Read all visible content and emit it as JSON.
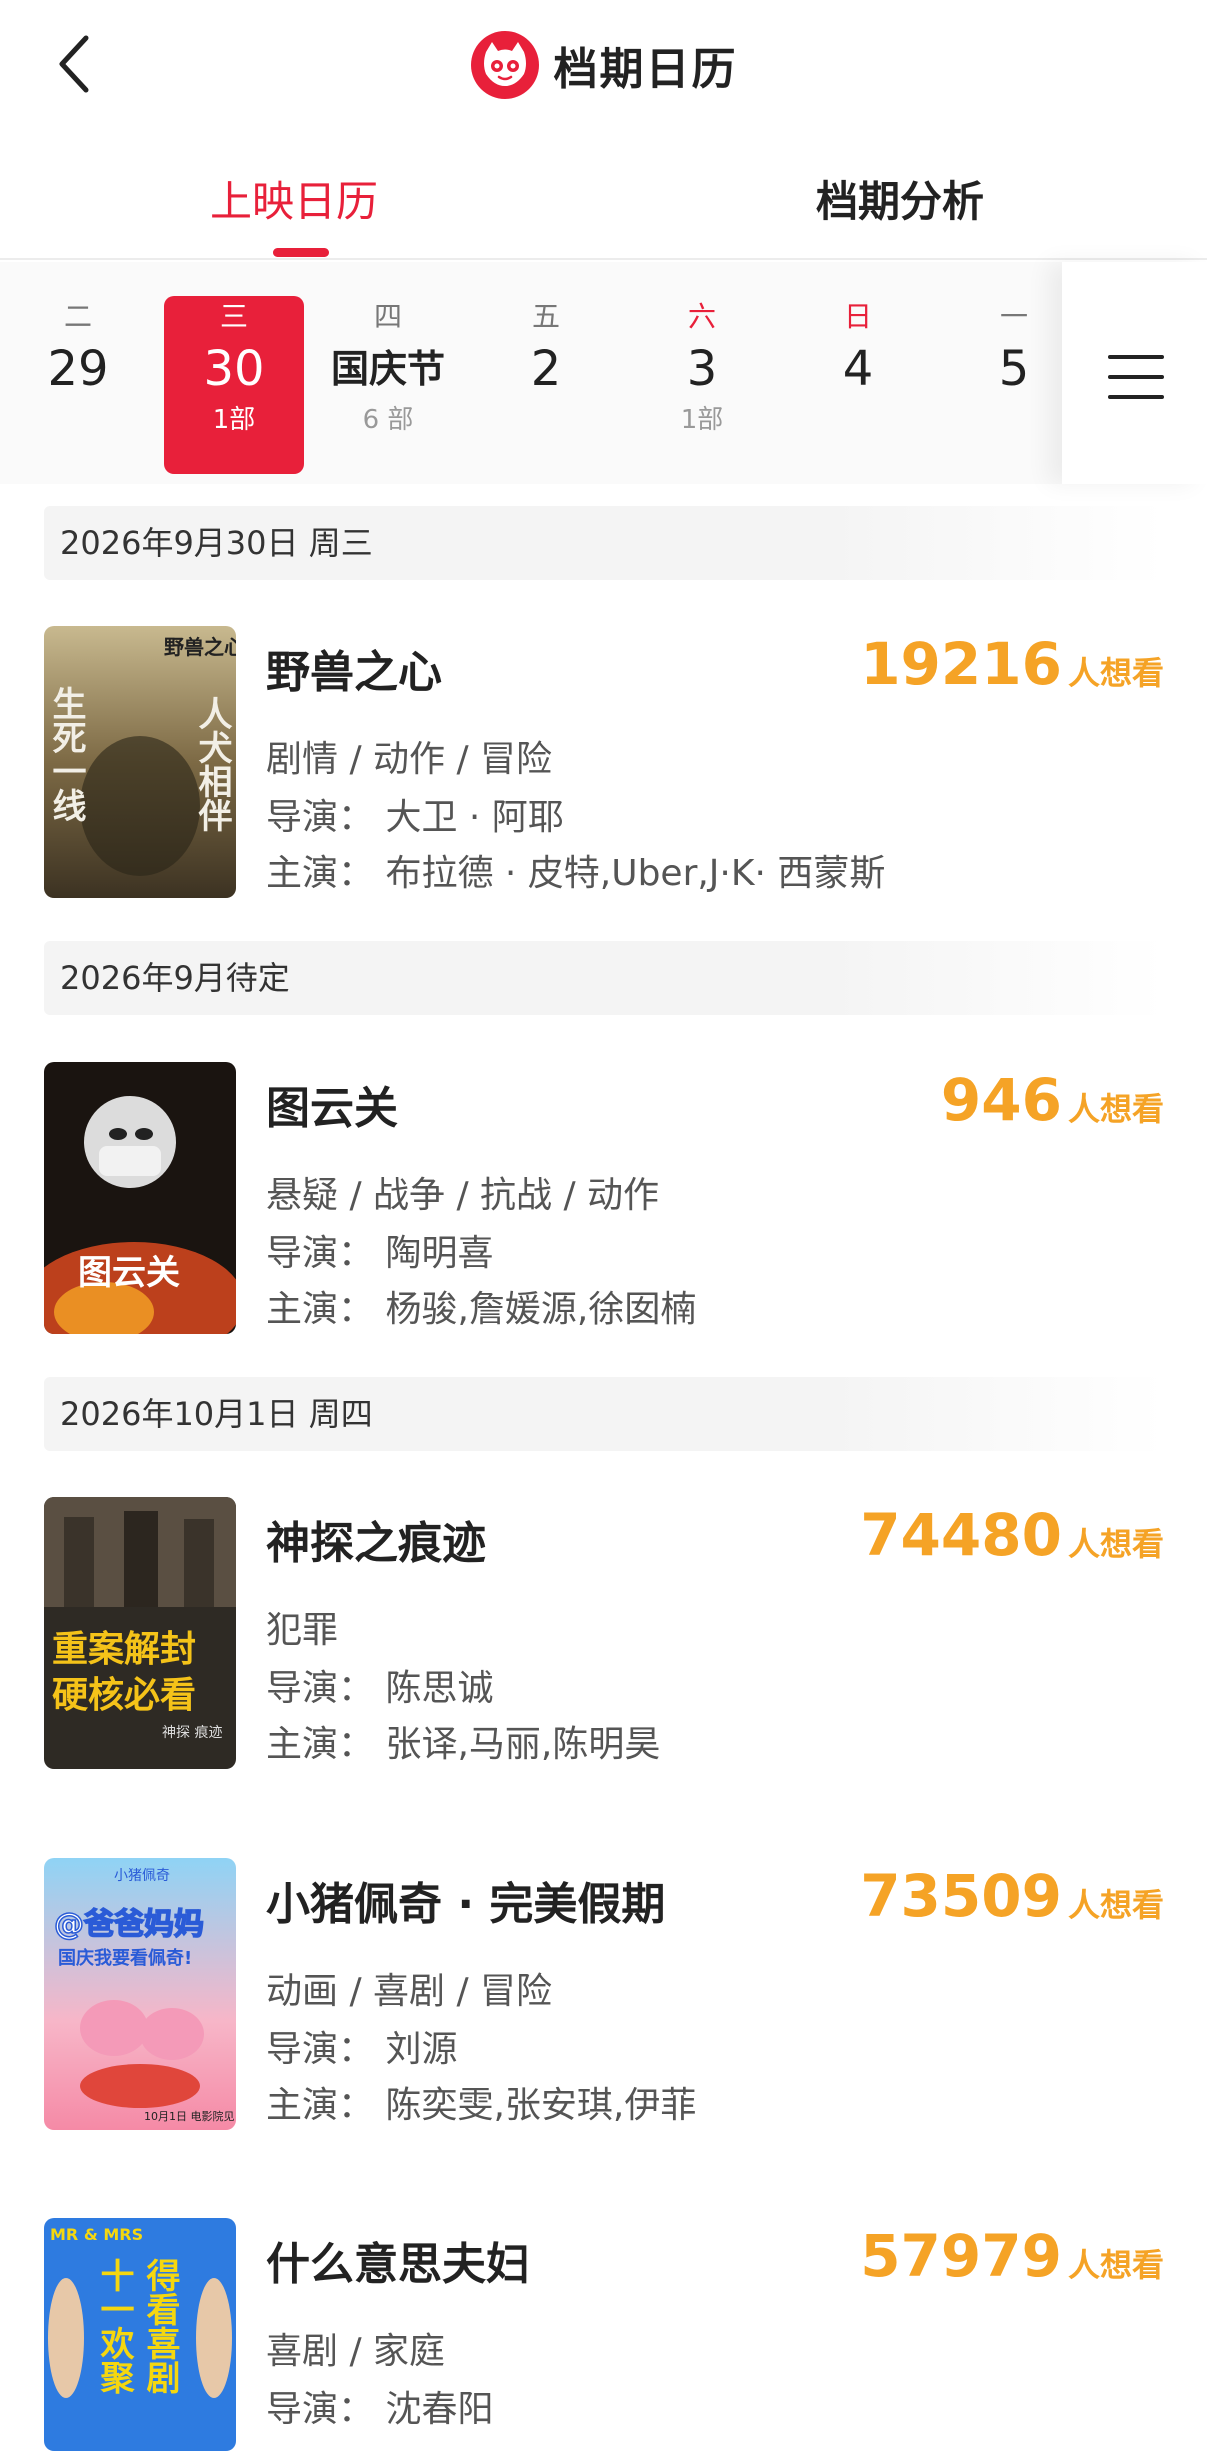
{
  "header": {
    "title": "档期日历"
  },
  "tabs": [
    {
      "label": "上映日历",
      "active": true
    },
    {
      "label": "档期分析",
      "active": false
    }
  ],
  "date_strip": [
    {
      "weekday": "二",
      "date": "29",
      "count": ""
    },
    {
      "weekday": "三",
      "date": "30",
      "count": "1部",
      "selected": true
    },
    {
      "weekday": "四",
      "date": "国庆节",
      "count": "6 部"
    },
    {
      "weekday": "五",
      "date": "2",
      "count": ""
    },
    {
      "weekday": "六",
      "date": "3",
      "count": "1部"
    },
    {
      "weekday": "日",
      "date": "4",
      "count": ""
    },
    {
      "weekday": "一",
      "date": "5",
      "count": ""
    }
  ],
  "sections": [
    {
      "header": "2026年9月30日  周三"
    },
    {
      "header": "2026年9月待定"
    },
    {
      "header": "2026年10月1日  周四"
    }
  ],
  "want_label": "人想看",
  "movies": [
    {
      "title": "野兽之心",
      "want": "19216",
      "genre": "剧情 / 动作 / 冒险",
      "director": "导演：  大卫 · 阿耶",
      "cast": "主演：  布拉德 · 皮特,Uber,J·K· 西蒙斯",
      "poster_text": [
        "野兽之心",
        "生死一线",
        "人犬相伴"
      ]
    },
    {
      "title": "图云关",
      "want": "946",
      "genre": "悬疑 / 战争 / 抗战 / 动作",
      "director": "导演：  陶明喜",
      "cast": "主演：  杨骏,詹媛源,徐囡楠",
      "poster_text": [
        "图云关"
      ]
    },
    {
      "title": "神探之痕迹",
      "want": "74480",
      "genre": "犯罪",
      "director": "导演：  陈思诚",
      "cast": "主演：  张译,马丽,陈明昊",
      "poster_text": [
        "重案解封",
        "硬核必看",
        "神探 痕迹"
      ]
    },
    {
      "title": "小猪佩奇 · 完美假期",
      "want": "73509",
      "genre": "动画 / 喜剧 / 冒险",
      "director": "导演：  刘源",
      "cast": "主演：  陈奕雯,张安琪,伊菲",
      "poster_text": [
        "小猪佩奇",
        "@爸爸妈妈",
        "国庆我要看佩奇!",
        "10月1日 电影院见"
      ]
    },
    {
      "title": "什么意思夫妇",
      "want": "57979",
      "genre": "喜剧 / 家庭",
      "director": "导演：  沈春阳",
      "cast": "",
      "poster_text": [
        "MR & MRS",
        "十一欢聚",
        "得看喜剧"
      ]
    }
  ],
  "colors": {
    "accent": "#e8203a",
    "want": "#f5a326",
    "section_bg": "#f4f4f4"
  }
}
